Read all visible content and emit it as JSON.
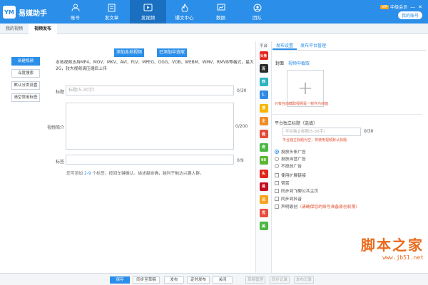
{
  "app": {
    "logo_mark": "YM",
    "logo_text": "易媒助手"
  },
  "nav": [
    {
      "label": "账号",
      "icon": "account-icon"
    },
    {
      "label": "发文章",
      "icon": "article-icon"
    },
    {
      "label": "发视频",
      "icon": "video-icon",
      "active": true
    },
    {
      "label": "爆文中心",
      "icon": "fire-icon"
    },
    {
      "label": "数据",
      "icon": "data-icon"
    },
    {
      "label": "团队",
      "icon": "team-icon"
    }
  ],
  "top_right": {
    "vip": "VIP",
    "member": "中级会员",
    "min": "—",
    "close": "✕",
    "account_btn": "我的账号"
  },
  "subtabs": [
    "我的视频",
    "视频发布"
  ],
  "sidebar": [
    "新建视频",
    "深度搜索",
    "默认分类设置",
    "清空常用标签"
  ],
  "main": {
    "add_local": "添加本地视频",
    "add_selected": "已添加中选取",
    "hint": "本地视频支持MP4、MOV、MKV、AVI、FLV、MPEG、OGG、VOB、WEBM、WMV、RMVB等格式，最大2G，较大视频请压缩后上传",
    "title_label": "标题",
    "title_placeholder": "标题(5-30字)",
    "title_counter": "0/30",
    "intro_label": "视频简介",
    "intro_counter": "0/200",
    "tags_label": "标签",
    "tags_counter": "0/9",
    "tip_pre": "您可添加",
    "tip_num": "2-9",
    "tip_post": "个标签，按回车键确认。描述越准确，越利于触达兴趣人群。"
  },
  "platform_col": {
    "header": "平台",
    "icons": [
      {
        "name": "toutiao-icon",
        "text": "头条",
        "color": "#e1251b"
      },
      {
        "name": "baijia-icon",
        "text": "百",
        "color": "#2a2a2a"
      },
      {
        "name": "ixigua-icon",
        "text": "西",
        "color": "#2bb3c0"
      },
      {
        "name": "yidian-icon",
        "text": "1.",
        "color": "#3189e6"
      },
      {
        "name": "sohu-icon",
        "text": "搜",
        "color": "#f7b500"
      },
      {
        "name": "qie-icon",
        "text": "企",
        "color": "#f08a24"
      },
      {
        "name": "weibo-icon",
        "text": "微",
        "color": "#e44a3a"
      },
      {
        "name": "iqiyi-icon",
        "text": "奇",
        "color": "#4cb843"
      },
      {
        "name": "360-icon",
        "text": "60",
        "color": "#5cb531"
      },
      {
        "name": "toutiao2-icon",
        "text": "头",
        "color": "#e1251b"
      },
      {
        "name": "netease-icon",
        "text": "易",
        "color": "#c30d23"
      },
      {
        "name": "dafeng-icon",
        "text": "凤",
        "color": "#f7a21b"
      },
      {
        "name": "youku-icon",
        "text": "优",
        "color": "#ea4c3f"
      },
      {
        "name": "meipai-icon",
        "text": "美",
        "color": "#4cb843"
      }
    ]
  },
  "right": {
    "tab_settings": "发布设置",
    "tab_manage": "发布平台管理",
    "cover_label": "封面",
    "cover_link": "视频中截取",
    "cover_warn": "只有在动截取视频是一帧作为封面",
    "ind_title_label": "平台独立标题（选填）",
    "ind_title_placeholder": "平台独立标题(5-30字)",
    "ind_title_counter": "0/30",
    "ind_note": "平台独立标题为空，将使用视频默认标题",
    "radios": [
      "投放头条广告",
      "投放自营广告",
      "不投放广告"
    ],
    "checks": [
      "使用扩展链接",
      "赞赏",
      "同步到飞聊公共主页",
      "同步到抖音"
    ],
    "decl_label": "声明原创",
    "decl_note": "（请确保您的账号具备原创权限）"
  },
  "bottom": {
    "save": "保存",
    "sync_draft": "同步至草稿",
    "publish": "发布",
    "timed": "定时发布",
    "close": "关闭",
    "r1": "草稿管理",
    "r2": "同步记录",
    "r3": "发布记录"
  },
  "watermark": {
    "big": "脚本之家",
    "small": "www.jb51.net"
  }
}
